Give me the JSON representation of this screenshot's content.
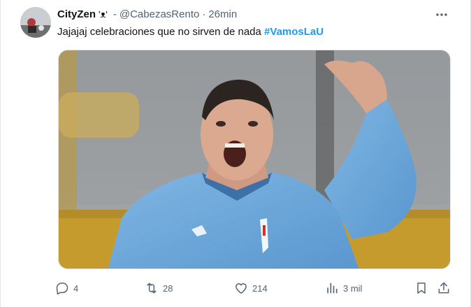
{
  "tweet": {
    "author_name": "CityZen",
    "author_emoji": "'ᴥ'",
    "separator": "-",
    "handle": "@CabezasRento",
    "dot": "·",
    "time": "26min",
    "more_icon": "ellipsis-icon",
    "text": "Jajajaj celebraciones que no sirven de nada",
    "hashtag": "#VamosLaU",
    "accent_color": "#1d9bf0"
  },
  "actions": {
    "reply_count": "4",
    "retweet_count": "28",
    "like_count": "214",
    "views_count": "3 mil",
    "icons": [
      "reply-icon",
      "retweet-icon",
      "like-icon",
      "views-icon",
      "bookmark-icon",
      "share-icon"
    ]
  }
}
